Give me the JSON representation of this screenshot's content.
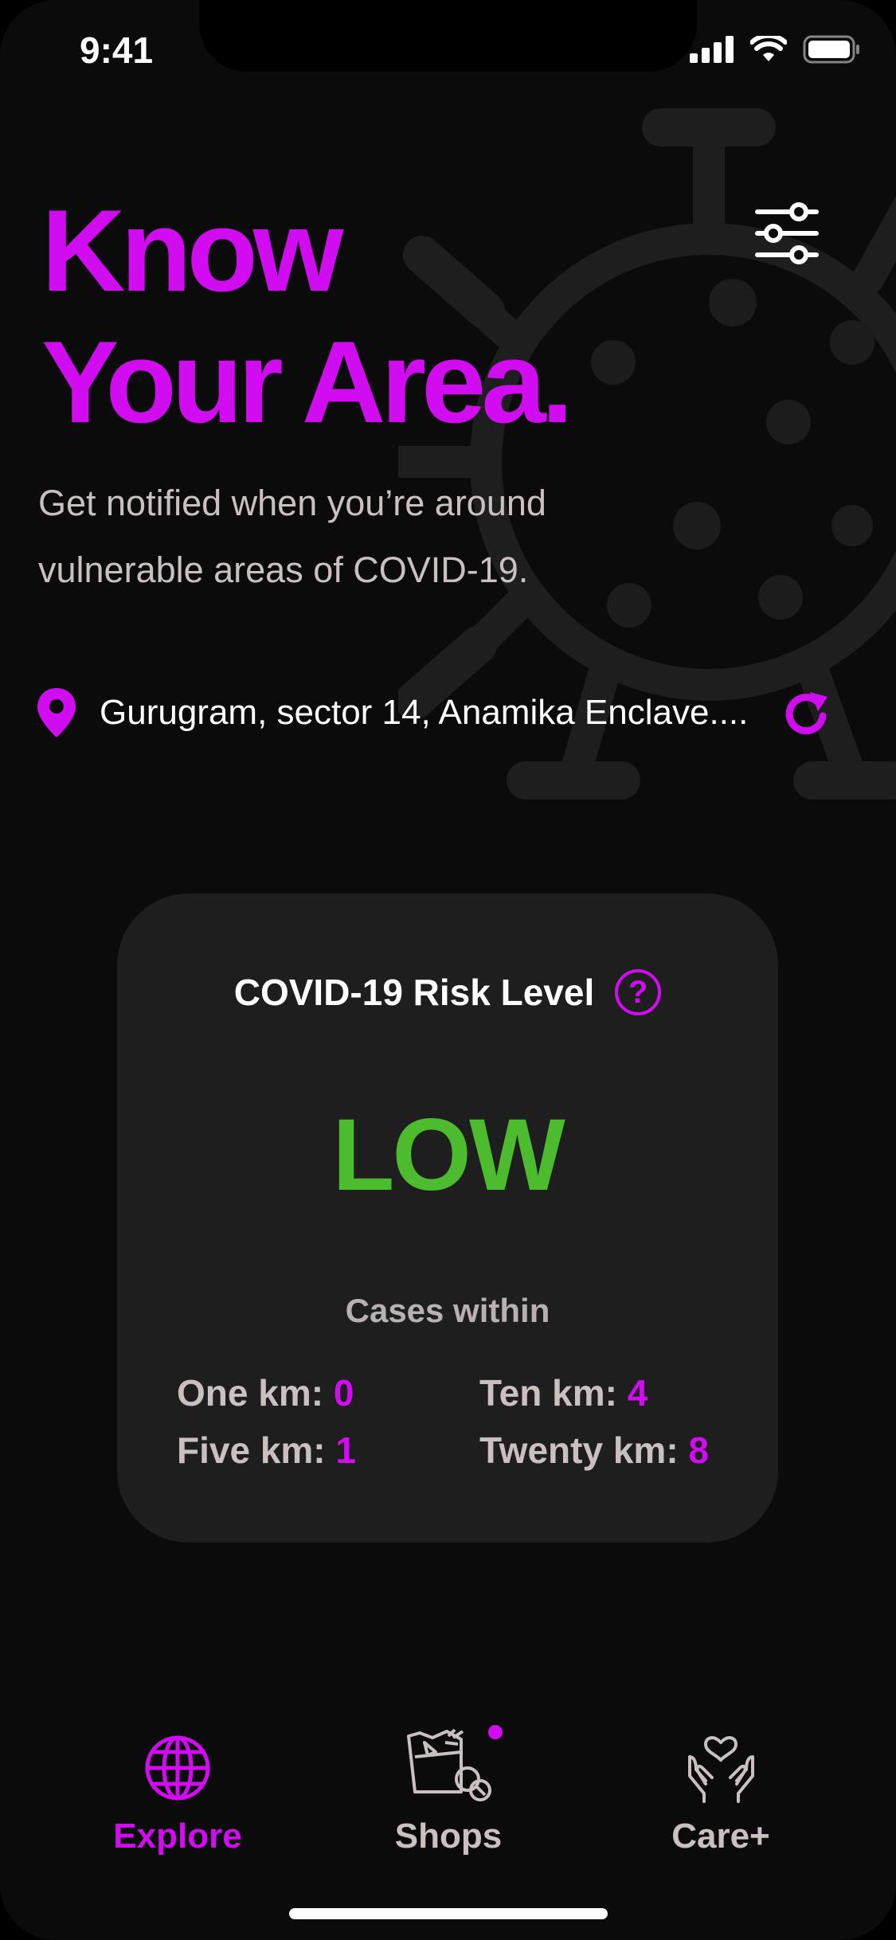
{
  "status_bar": {
    "time": "9:41",
    "icons": [
      "cellular-signal-icon",
      "wifi-icon",
      "battery-icon"
    ]
  },
  "header": {
    "title_line1": "Know",
    "title_line2": "Your Area.",
    "subtitle": "Get notified when you’re around vulnerable areas of COVID-19.",
    "filter_icon": "sliders-icon"
  },
  "location": {
    "icon": "map-pin-icon",
    "text": "Gurugram, sector 14, Anamika Enclave....",
    "refresh_icon": "refresh-icon"
  },
  "risk_card": {
    "title": "COVID-19 Risk Level",
    "help_glyph": "?",
    "level": "LOW",
    "cases_label": "Cases within",
    "stats": [
      {
        "label": "One km:",
        "value": "0"
      },
      {
        "label": "Ten km:",
        "value": "4"
      },
      {
        "label": "Five km:",
        "value": "1"
      },
      {
        "label": "Twenty km:",
        "value": "8"
      }
    ]
  },
  "tab_bar": {
    "tabs": [
      {
        "label": "Explore",
        "icon": "globe-icon",
        "active": true
      },
      {
        "label": "Shops",
        "icon": "grocery-bag-icon",
        "active": false,
        "has_badge": true
      },
      {
        "label": "Care+",
        "icon": "heart-hands-icon",
        "active": false
      }
    ]
  },
  "colors": {
    "accent": "#d20cf0",
    "background": "#0b0b0b",
    "card": "#1e1e1f",
    "risk_low": "#4cbb2d",
    "muted_text": "#cbc0c0"
  }
}
